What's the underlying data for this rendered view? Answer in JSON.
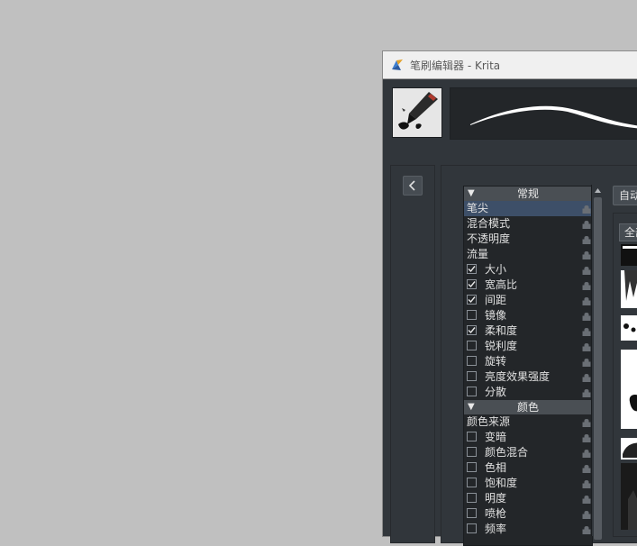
{
  "window": {
    "title": "笔刷编辑器 - Krita"
  },
  "options": {
    "sections": [
      {
        "header": "常规",
        "items": [
          {
            "label": "笔尖",
            "checkbox": false,
            "selected": true
          },
          {
            "label": "混合模式",
            "checkbox": false
          },
          {
            "label": "不透明度",
            "checkbox": false
          },
          {
            "label": "流量",
            "checkbox": false
          },
          {
            "label": "大小",
            "checkbox": true,
            "checked": true
          },
          {
            "label": "宽高比",
            "checkbox": true,
            "checked": true
          },
          {
            "label": "间距",
            "checkbox": true,
            "checked": true
          },
          {
            "label": "镜像",
            "checkbox": true,
            "checked": false
          },
          {
            "label": "柔和度",
            "checkbox": true,
            "checked": true
          },
          {
            "label": "锐利度",
            "checkbox": true,
            "checked": false
          },
          {
            "label": "旋转",
            "checkbox": true,
            "checked": false
          },
          {
            "label": "亮度效果强度",
            "checkbox": true,
            "checked": false
          },
          {
            "label": "分散",
            "checkbox": true,
            "checked": false
          }
        ]
      },
      {
        "header": "颜色",
        "items": [
          {
            "label": "颜色来源",
            "checkbox": false
          },
          {
            "label": "变暗",
            "checkbox": true,
            "checked": false
          },
          {
            "label": "颜色混合",
            "checkbox": true,
            "checked": false
          },
          {
            "label": "色相",
            "checkbox": true,
            "checked": false
          },
          {
            "label": "饱和度",
            "checkbox": true,
            "checked": false
          },
          {
            "label": "明度",
            "checkbox": true,
            "checked": false
          },
          {
            "label": "喷枪",
            "checkbox": true,
            "checked": false
          },
          {
            "label": "频率",
            "checkbox": true,
            "checked": false
          }
        ]
      }
    ]
  },
  "right": {
    "auto_button": "自动",
    "tab_all": "全部"
  },
  "icons": {
    "app": "krita-icon",
    "collapse": "chevron-left-icon",
    "lock": "lock-icon",
    "check": "check-icon"
  },
  "colors": {
    "window_bg": "#31363b",
    "list_bg": "#232629",
    "selection": "#3d4f68",
    "desktop": "#c0c0c0"
  }
}
